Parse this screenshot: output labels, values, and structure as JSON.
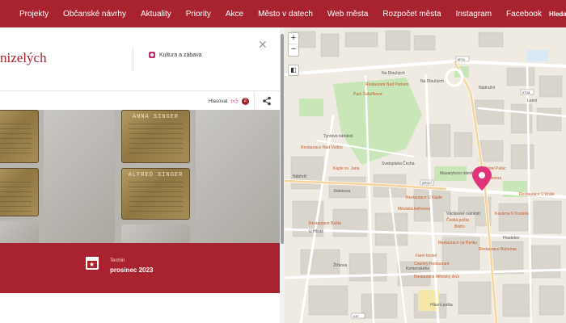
{
  "nav": {
    "items": [
      "Projekty",
      "Občanské návrhy",
      "Aktuality",
      "Priority",
      "Akce",
      "Město v datech",
      "Web města",
      "Rozpočet města",
      "Instagram",
      "Facebook"
    ],
    "search_label": "Hledat"
  },
  "detail": {
    "title": "nizelých",
    "category": "Kultura a zábava",
    "close_icon": "close-icon",
    "vote_label": "Hlasovat",
    "vote_count": "2",
    "photo_stones": [
      "ANNA SINGER",
      "ALFRED SINGER"
    ],
    "term_label": "Termín",
    "term_value": "prosinec 2023"
  },
  "map": {
    "zoom_in": "+",
    "zoom_out": "−",
    "street_labels": [
      "Na Dlouhých",
      "Na Dlouhých",
      "Nádražní",
      "Nábřeží",
      "Lesní",
      "Svatopluka Čecha",
      "Tyršovo náměstí",
      "Jiráskova",
      "Václavské náměstí",
      "Masarykovo náměstí",
      "U Hřiště",
      "Komenského",
      "Žižkova",
      "Hlavní pošta",
      "Hradební"
    ],
    "poi_labels": [
      "Park Šafaříkova",
      "Restaurant Nad Parkem",
      "Restaurace Nad Vodou",
      "Hotel Palác",
      "Restaurace Bašta",
      "Bistro",
      "Česká pošta",
      "Kaple sv. Jana",
      "Lékárna",
      "Restaurace U Kaple",
      "Restaurace na Rynku",
      "Restaurace Městský dvůr",
      "Restaurace Bohemia",
      "Country Restaurant",
      "Farní kostel",
      "Městská knihovna",
      "Kavárna U Kostela",
      "Restaurace U Krále"
    ],
    "road_numbers": [
      "IIP11",
      "IIT44",
      "AP017",
      "I/37"
    ],
    "colors": {
      "park": "#c8e6b8",
      "road": "#ffffff",
      "building": "#d9d4cc",
      "marker": "#e0337a"
    }
  }
}
